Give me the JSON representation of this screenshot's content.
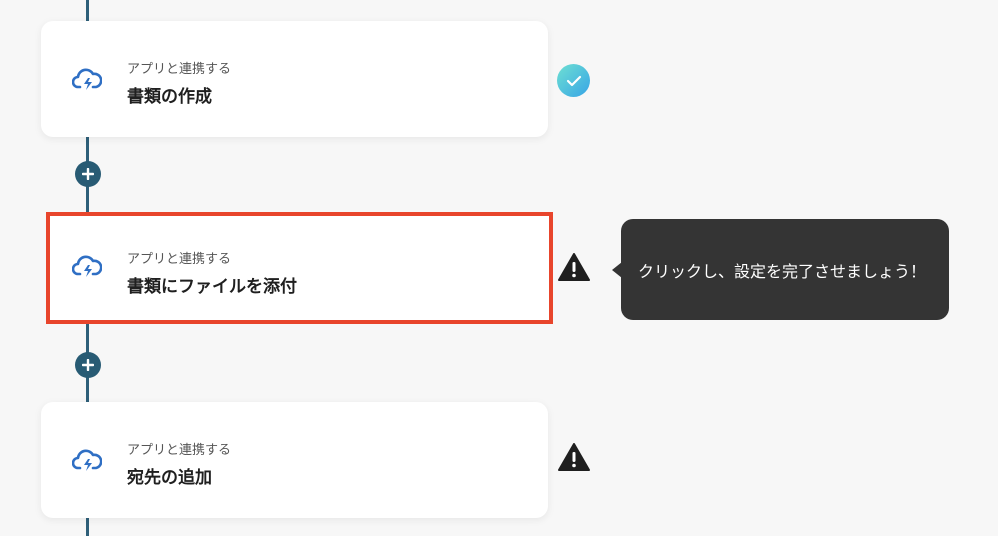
{
  "flow": {
    "steps": [
      {
        "subtitle": "アプリと連携する",
        "title": "書類の作成",
        "status": "complete",
        "icon": "cloud-app-icon"
      },
      {
        "subtitle": "アプリと連携する",
        "title": "書類にファイルを添付",
        "status": "warning",
        "icon": "cloud-app-icon"
      },
      {
        "subtitle": "アプリと連携する",
        "title": "宛先の追加",
        "status": "warning",
        "icon": "cloud-app-icon"
      }
    ],
    "add_button_icon": "plus-icon"
  },
  "tooltip": {
    "text": "クリックし、設定を完了させましょう！"
  },
  "colors": {
    "line": "#2e5f79",
    "add_button": "#285b74",
    "highlight_border": "#e8452c",
    "tooltip_bg": "#343434",
    "app_icon": "#2f6fc4",
    "check_gradient_start": "#6ee0d2",
    "check_gradient_end": "#37a4e6",
    "warning": "#1f1f1f"
  }
}
